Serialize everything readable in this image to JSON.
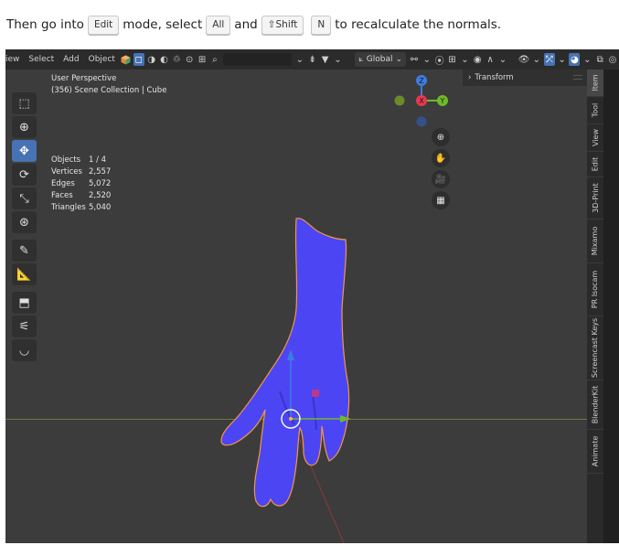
{
  "instruction": {
    "before": "Then go into",
    "key_edit": "Edit",
    "mid1": "mode, select",
    "key_all": "All",
    "mid2": "and",
    "key_shift": "⇧Shift",
    "key_n": "N",
    "after": "to recalculate the normals."
  },
  "header": {
    "menus": [
      "iew",
      "Select",
      "Add",
      "Object"
    ],
    "transform_orientation": "Global"
  },
  "viewport": {
    "perspective": "User Perspective",
    "collection": "(356) Scene Collection | Cube",
    "stats": [
      {
        "label": "Objects",
        "value": "1 / 4"
      },
      {
        "label": "Vertices",
        "value": "2,557"
      },
      {
        "label": "Edges",
        "value": "5,072"
      },
      {
        "label": "Faces",
        "value": "2,520"
      },
      {
        "label": "Triangles",
        "value": "5,040"
      }
    ],
    "gizmo_labels": {
      "z": "Z",
      "x": "X",
      "y": "Y"
    }
  },
  "npanel": {
    "section": "Transform"
  },
  "tabs": [
    "Item",
    "Tool",
    "View",
    "Edit",
    "3D-Print",
    "Mixamo",
    "PR Isocam",
    "Screencast Keys",
    "BlenderKit",
    "Animate"
  ],
  "colors": {
    "mesh": "#4c45f4",
    "mesh_outline": "#f0964a",
    "accent": "#4772b3",
    "axis_x": "#e8384f",
    "axis_y": "#6fba2a",
    "axis_z": "#3c7de0"
  }
}
